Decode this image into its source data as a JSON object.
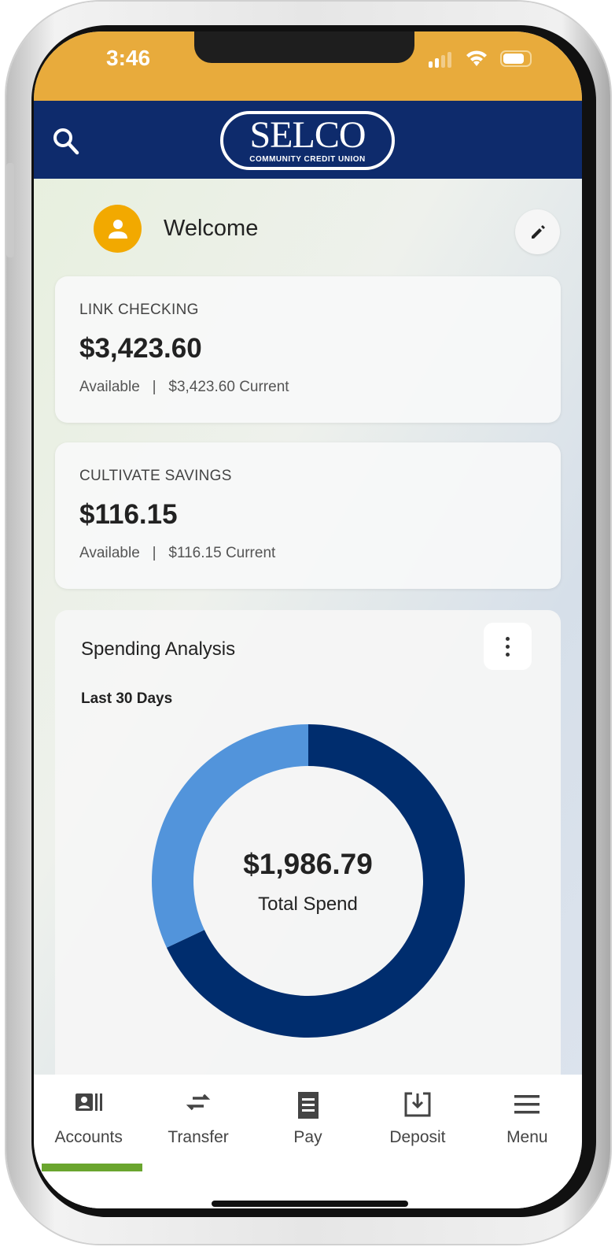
{
  "status_bar": {
    "time": "3:46",
    "icons": [
      "cellular-signal-icon",
      "wifi-icon",
      "battery-icon"
    ]
  },
  "header": {
    "logo_main": "SELCO",
    "logo_sub": "COMMUNITY CREDIT UNION",
    "search_icon": "search-icon"
  },
  "welcome": {
    "text": "Welcome"
  },
  "accounts": [
    {
      "name": "LINK CHECKING",
      "balance": "$3,423.60",
      "available_label": "Available",
      "separator": "|",
      "current": "$3,423.60 Current"
    },
    {
      "name": "CULTIVATE SAVINGS",
      "balance": "$116.15",
      "available_label": "Available",
      "separator": "|",
      "current": "$116.15 Current"
    }
  ],
  "spending": {
    "title": "Spending Analysis",
    "range": "Last 30 Days",
    "total": "$1,986.79",
    "total_label": "Total Spend"
  },
  "chart_data": {
    "type": "pie",
    "variant": "donut",
    "values": [
      68,
      32
    ],
    "unit": "percent of total (estimated)",
    "colors": [
      "#002d6e",
      "#5294db"
    ],
    "center_text": "$1,986.79",
    "center_label": "Total Spend"
  },
  "nav": {
    "items": [
      {
        "label": "Accounts",
        "icon": "accounts-icon",
        "active": true
      },
      {
        "label": "Transfer",
        "icon": "transfer-icon"
      },
      {
        "label": "Pay",
        "icon": "receipt-icon"
      },
      {
        "label": "Deposit",
        "icon": "deposit-icon"
      },
      {
        "label": "Menu",
        "icon": "menu-icon"
      }
    ]
  },
  "colors": {
    "status_bar": "#e8ab3c",
    "header": "#0e2b6c",
    "avatar": "#f2a900",
    "active_tab": "#6aa52e"
  }
}
